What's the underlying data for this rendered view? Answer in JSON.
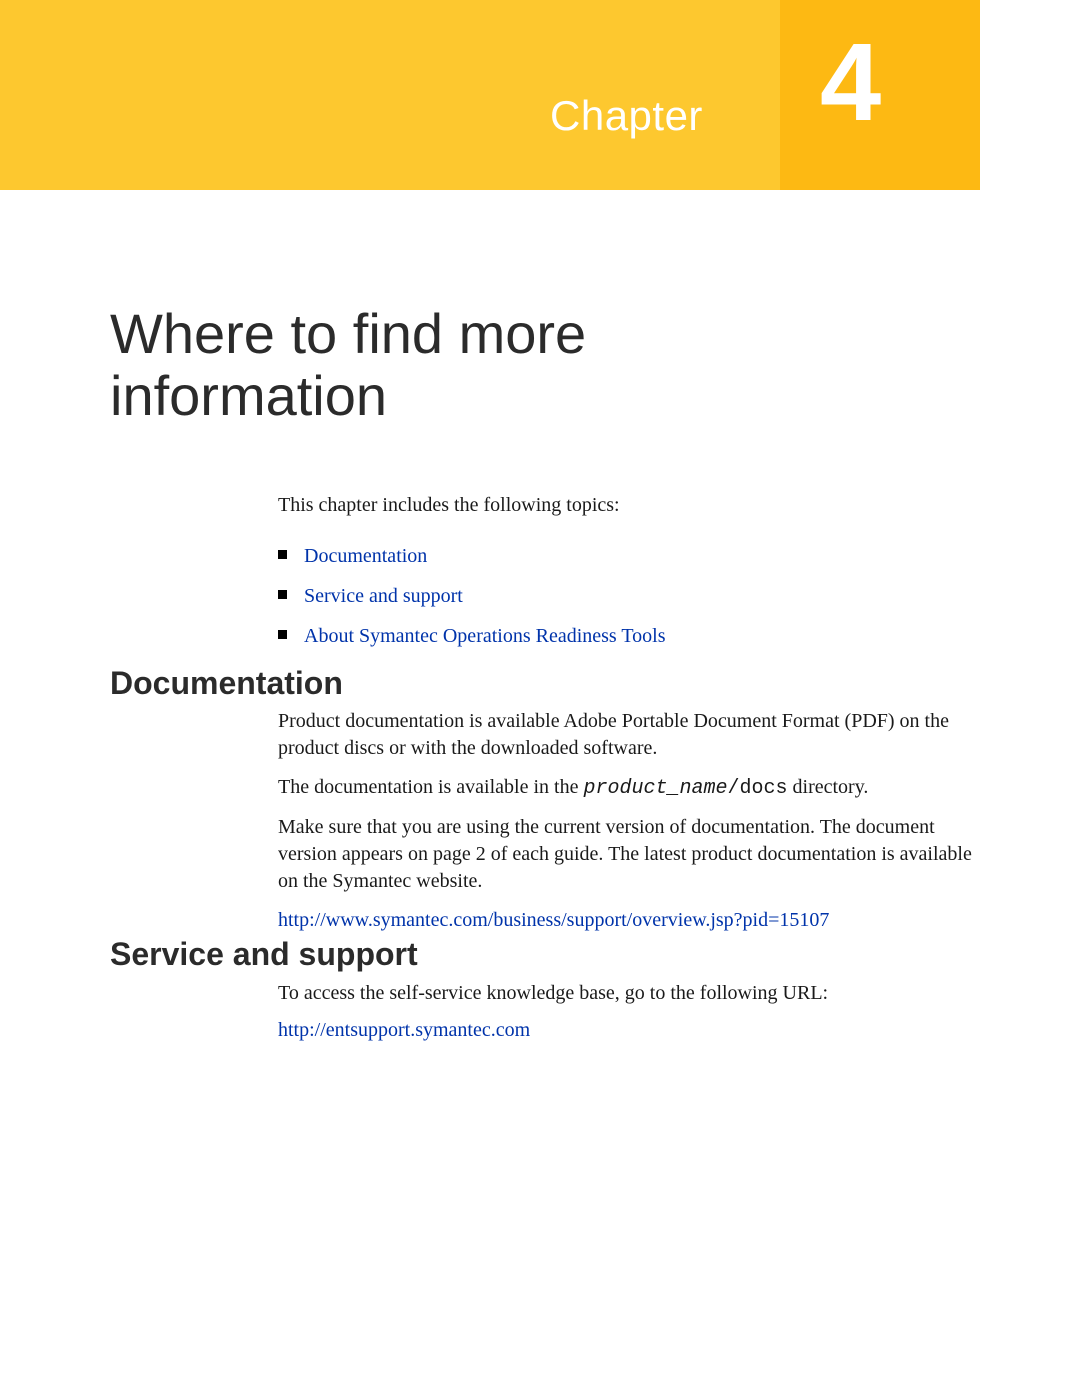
{
  "banner": {
    "label": "Chapter",
    "number": "4"
  },
  "title": "Where to find more information",
  "intro": "This chapter includes the following topics:",
  "topics": [
    "Documentation",
    "Service and support",
    "About Symantec Operations Readiness Tools"
  ],
  "sections": {
    "documentation": {
      "heading": "Documentation",
      "p1": "Product documentation is available Adobe Portable Document Format (PDF) on the product discs or with the downloaded software.",
      "p2_pre": "The documentation is available in the ",
      "p2_path1": "product_name",
      "p2_path2": "/docs",
      "p2_post": " directory.",
      "p3": "Make sure that you are using the current version of documentation. The document version appears on page 2 of each guide. The latest product documentation is available on the Symantec website.",
      "link": "http://www.symantec.com/business/support/overview.jsp?pid=15107"
    },
    "service": {
      "heading": "Service and support",
      "p1": "To access the self-service knowledge base, go to the following URL:",
      "link": "http://entsupport.symantec.com"
    }
  }
}
